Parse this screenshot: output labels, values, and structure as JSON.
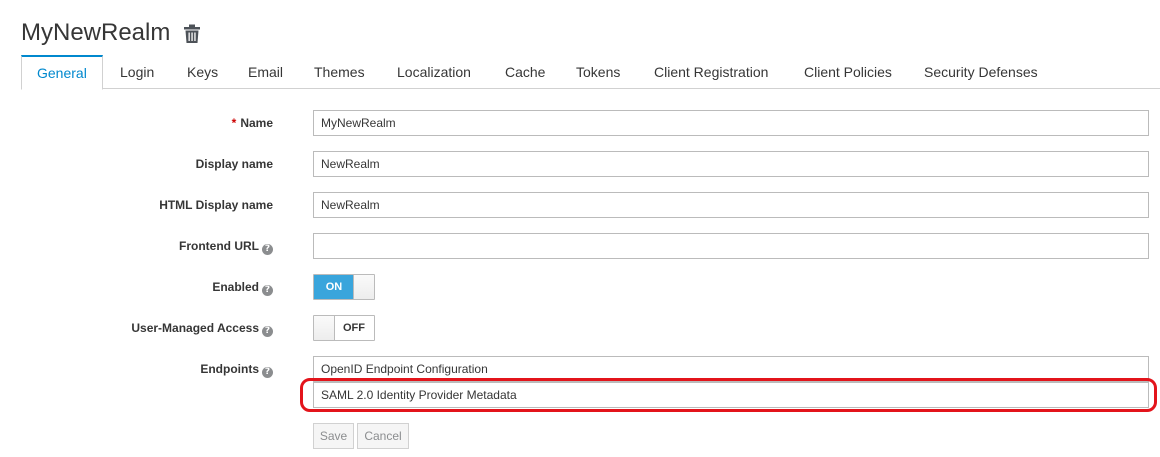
{
  "header": {
    "realm_title": "MyNewRealm",
    "delete_icon": "trash-icon"
  },
  "tabs": [
    {
      "label": "General",
      "active": true
    },
    {
      "label": "Login"
    },
    {
      "label": "Keys"
    },
    {
      "label": "Email"
    },
    {
      "label": "Themes"
    },
    {
      "label": "Localization"
    },
    {
      "label": "Cache"
    },
    {
      "label": "Tokens"
    },
    {
      "label": "Client Registration"
    },
    {
      "label": "Client Policies"
    },
    {
      "label": "Security Defenses"
    }
  ],
  "form": {
    "name": {
      "required_marker": "*",
      "label": "Name",
      "value": "MyNewRealm"
    },
    "display_name": {
      "label": "Display name",
      "value": "NewRealm"
    },
    "html_display_name": {
      "label": "HTML Display name",
      "value": "NewRealm"
    },
    "frontend_url": {
      "label": "Frontend URL",
      "value": ""
    },
    "enabled": {
      "label": "Enabled",
      "state": "ON"
    },
    "user_managed_access": {
      "label": "User-Managed Access",
      "state": "OFF"
    },
    "endpoints": {
      "label": "Endpoints",
      "items": [
        "OpenID Endpoint Configuration",
        "SAML 2.0 Identity Provider Metadata"
      ]
    },
    "help_glyph": "?"
  },
  "actions": {
    "save_label": "Save",
    "cancel_label": "Cancel"
  },
  "colors": {
    "accent": "#0088ce",
    "switch_on": "#39a5dc",
    "highlight": "#e3141b"
  }
}
